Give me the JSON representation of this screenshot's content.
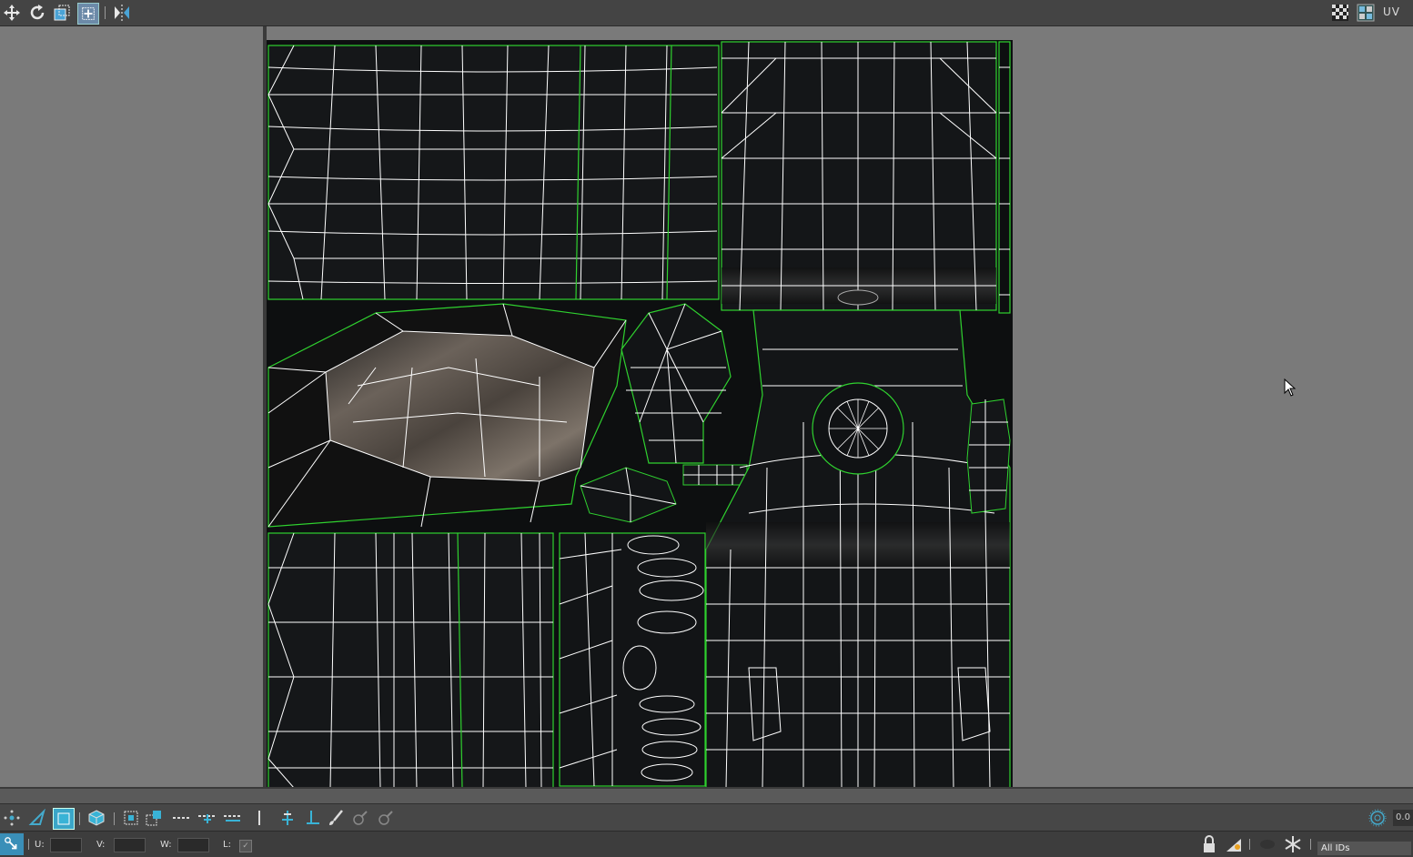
{
  "topbar": {
    "tools": [
      "move-icon",
      "rotate-icon",
      "scale-icon",
      "freeform-icon",
      "mirror-icon"
    ],
    "right_label": "UV",
    "right_tools": [
      "checker-pattern-icon",
      "texture-map-icon"
    ]
  },
  "bottom_toolbar": {
    "tools": [
      "vertex-select-icon",
      "edge-select-icon",
      "face-select-icon",
      "element-select-icon",
      "grow-select-icon",
      "shrink-select-icon",
      "loop-icon",
      "ring-icon",
      "paint-select-icon"
    ],
    "value": "0.0"
  },
  "status": {
    "u_label": "U:",
    "v_label": "V:",
    "w_label": "W:",
    "l_label": "L:",
    "ids_dropdown": "All IDs"
  },
  "colors": {
    "island_border": "#2fd12f",
    "wire": "#ffffff",
    "panel_bg": "#0d0f10"
  }
}
